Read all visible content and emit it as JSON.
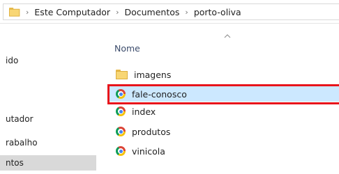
{
  "breadcrumb": {
    "separator": "›",
    "items": [
      "Este Computador",
      "Documentos",
      "porto-oliva"
    ]
  },
  "navpane": {
    "items": [
      {
        "label": "ido",
        "selected": false
      },
      {
        "label": "utador",
        "selected": false
      },
      {
        "label": "rabalho",
        "selected": false
      },
      {
        "label": "ntos",
        "selected": true
      }
    ]
  },
  "filelist": {
    "column_header": "Nome",
    "sort": "ascending",
    "files": [
      {
        "name": "imagens",
        "icon": "folder-icon",
        "selected": false
      },
      {
        "name": "fale-conosco",
        "icon": "chrome-icon",
        "selected": true
      },
      {
        "name": "index",
        "icon": "chrome-icon",
        "selected": false
      },
      {
        "name": "produtos",
        "icon": "chrome-icon",
        "selected": false
      },
      {
        "name": "vinicola",
        "icon": "chrome-icon",
        "selected": false
      }
    ]
  },
  "colors": {
    "selection": "#cce8ff",
    "highlight_border": "#e8141b",
    "nav_selected": "#d9d9d9"
  }
}
